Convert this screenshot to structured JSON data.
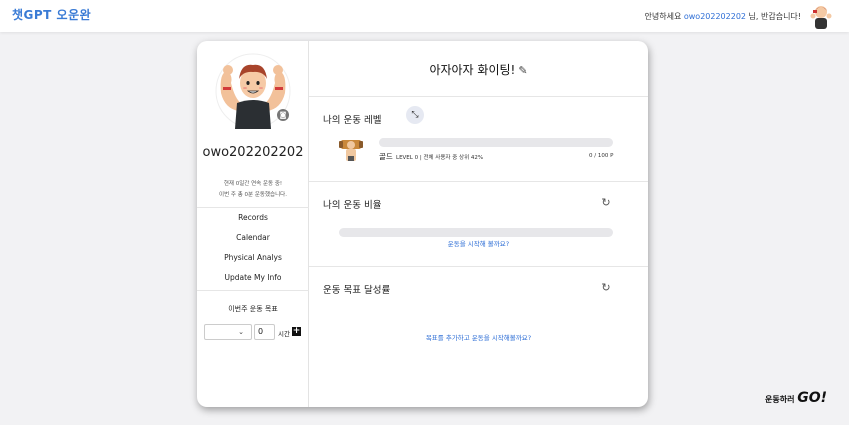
{
  "header": {
    "logo": "챗GPT 오운완",
    "greeting_prefix": "안녕하세요 ",
    "username": "owo202202202",
    "greeting_suffix": " 님, 반갑습니다!"
  },
  "profile": {
    "username": "owo202202202",
    "streak_line1": "현재 0일간 연속 운동 중!",
    "streak_line2": "이번 주 총 0분 운동했습니다."
  },
  "menu": {
    "items": [
      {
        "label": "Records"
      },
      {
        "label": "Calendar"
      },
      {
        "label": "Physical Analys"
      },
      {
        "label": "Update My Info"
      }
    ]
  },
  "weekly_goal": {
    "title": "이번주 운동 목표",
    "select_value": "",
    "hours_value": "0",
    "unit_label": "시간",
    "add_label": "+"
  },
  "main": {
    "slogan": "아자아자 화이팅!",
    "level": {
      "title": "나의 운동 레벨",
      "tier": "골드",
      "info": "LEVEL 0  |   전체 사용자 중 상위 42%",
      "points": "0 / 100 P",
      "progress": 0
    },
    "ratio": {
      "title": "나의 운동 비율",
      "progress": 0,
      "link": "운동을 시작해 볼까요?"
    },
    "goal_rate": {
      "title": "운동 목표 달성률",
      "link": "목표를 추가하고 운동을 시작해볼까요?"
    }
  },
  "brand": {
    "text": "운동하러 ",
    "go": "GO!"
  },
  "colors": {
    "accent": "#2f6fd6",
    "background": "#f2f2f4",
    "bar_track": "#e7e7ea"
  }
}
